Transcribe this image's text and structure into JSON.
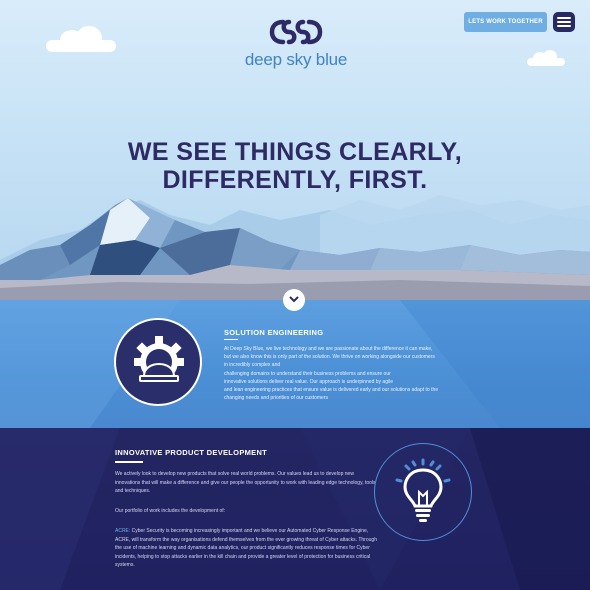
{
  "brand": {
    "name": "deep sky blue",
    "logo_color": "#3f83c4",
    "icon": "css-cloud-logo-icon"
  },
  "nav": {
    "cta_label": "LETS WORK TOGETHER",
    "menu_icon": "hamburger-menu-icon"
  },
  "hero": {
    "headline_line1": "WE SEE THINGS CLEARLY,",
    "headline_line2": "DIFFERENTLY, FIRST.",
    "scroll_icon": "chevron-down-icon"
  },
  "solution": {
    "title": "SOLUTION ENGINEERING",
    "icon": "gear-hardhat-icon",
    "lines": [
      "At Deep Sky Blue, we live technology and we are passionate about the difference it can make,",
      "but we also know this is only part of the solution. We thrive on working alongside our customers",
      "in incredibly complex and",
      "challenging domains to understand their business problems and ensure our",
      "innovative solutions deliver real value. Our approach is underpinned by agile",
      "and lean engineering practices that ensure value is delivered early and our solutions adapt to the",
      "changing needs and priorities of our customers"
    ]
  },
  "innovation": {
    "title": "INNOVATIVE PRODUCT DEVELOPMENT",
    "icon": "lightbulb-icon",
    "para1": "We actively look to develop new products that solve real world problems. Our values lead us to develop new innovations that will make a difference and give our people the opportunity to work with leading edge technology, tools and techniques.",
    "para2": "Our portfolio of work includes the development of:",
    "para3_highlight": "ACRE:",
    "para3_rest": " Cyber Security is becoming increasingly important and we believe our Automated Cyber Response Engine, ACRE, will transform the way organisations defend themselves from the ever growing threat of Cyber attacks. Through the use of machine learning and dynamic data analytics, our product significantly reduces response times for Cyber incidents, helping to stop attacks earlier in the kill chain and provide a greater level of protection for business critical systems."
  },
  "colors": {
    "navy": "#2e2a63",
    "button_blue": "#6faee3",
    "section_blue": "#4b8fd5",
    "deep_navy": "#242664"
  }
}
